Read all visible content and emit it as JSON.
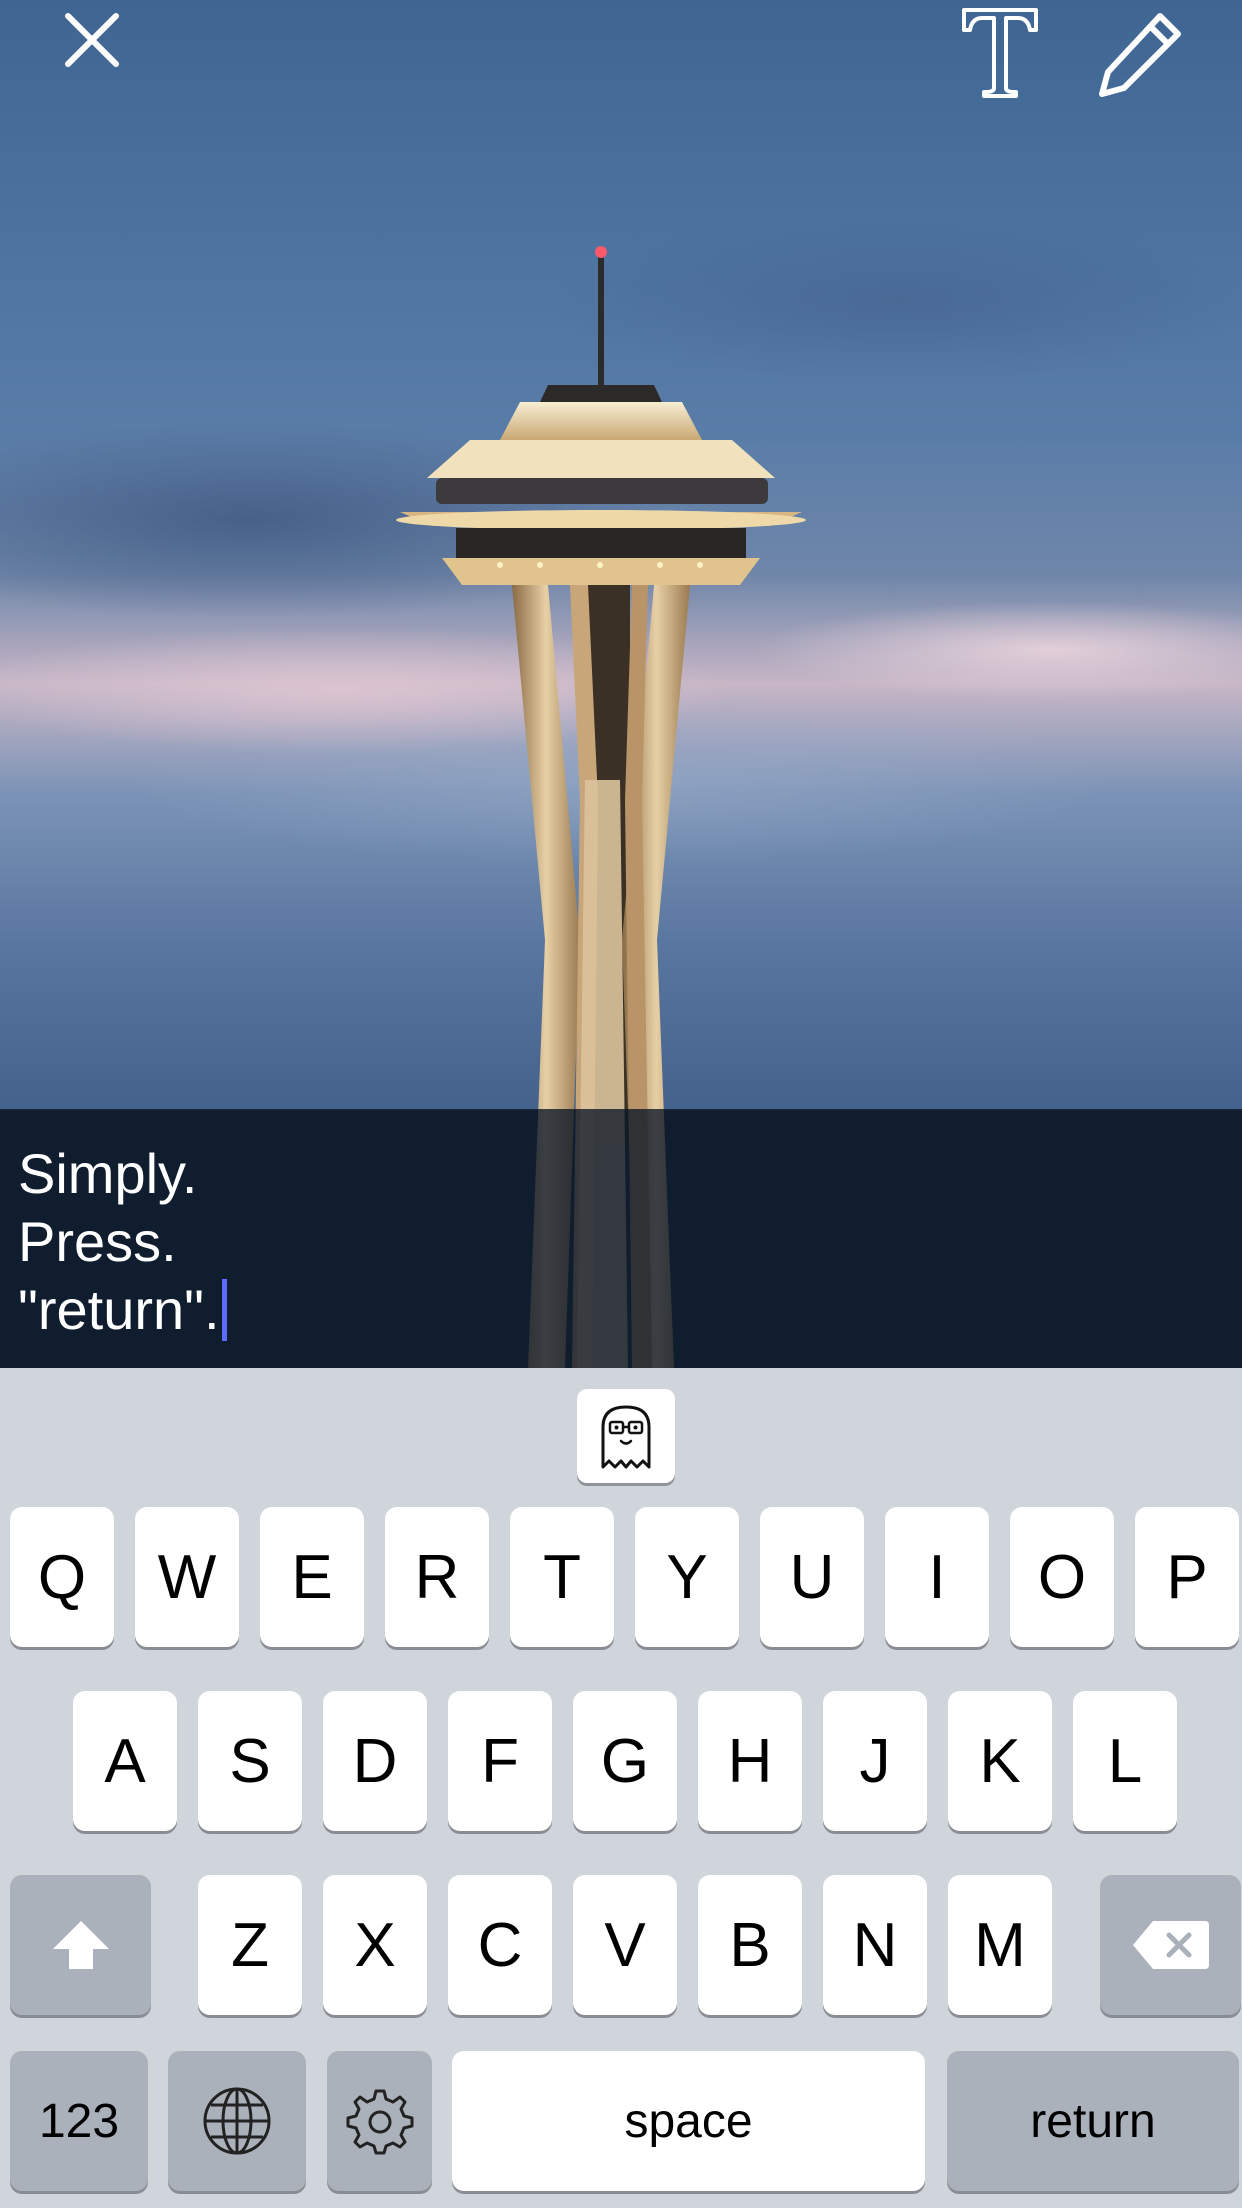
{
  "toolbar": {
    "close_icon": "close-icon",
    "text_tool_icon": "text-tool-icon",
    "pencil_icon": "pencil-icon"
  },
  "caption": {
    "lines": [
      "Simply.",
      "Press.",
      "\"return\"."
    ]
  },
  "keyboard": {
    "bitmoji_icon": "bitmoji-ghost-icon",
    "row1": [
      "Q",
      "W",
      "E",
      "R",
      "T",
      "Y",
      "U",
      "I",
      "O",
      "P"
    ],
    "row2": [
      "A",
      "S",
      "D",
      "F",
      "G",
      "H",
      "J",
      "K",
      "L"
    ],
    "row3": [
      "Z",
      "X",
      "C",
      "V",
      "B",
      "N",
      "M"
    ],
    "shift_icon": "shift-icon",
    "delete_icon": "delete-icon",
    "numbers_label": "123",
    "globe_icon": "globe-icon",
    "settings_icon": "gear-icon",
    "space_label": "space",
    "return_label": "return"
  }
}
